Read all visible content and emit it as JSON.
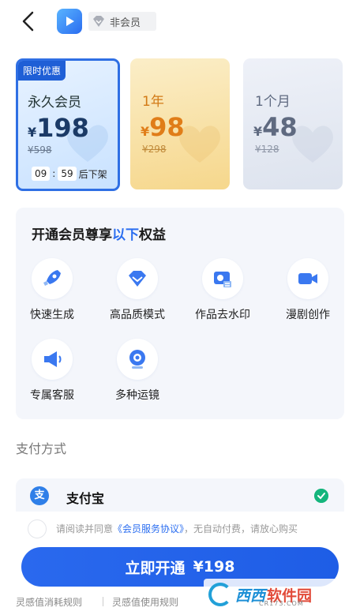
{
  "header": {
    "member_status": "非会员"
  },
  "plans": [
    {
      "tag": "限时优惠",
      "name": "永久会员",
      "currency": "¥",
      "price": "198",
      "original": "¥598",
      "countdown": {
        "hours": "09",
        "minutes": "59",
        "suffix": "后下架"
      },
      "selected": true
    },
    {
      "name": "1年",
      "currency": "¥",
      "price": "98",
      "original": "¥298",
      "selected": false
    },
    {
      "name": "1个月",
      "currency": "¥",
      "price": "48",
      "original": "¥128",
      "selected": false
    }
  ],
  "benefits": {
    "title_prefix": "开通会员尊享",
    "title_highlight": "以下",
    "title_suffix": "权益",
    "items": [
      {
        "label": "快速生成",
        "icon": "rocket-icon"
      },
      {
        "label": "高品质模式",
        "icon": "diamond-icon"
      },
      {
        "label": "作品去水印",
        "icon": "watermark-removal-icon"
      },
      {
        "label": "漫剧创作",
        "icon": "video-camera-icon"
      },
      {
        "label": "专属客服",
        "icon": "megaphone-icon"
      },
      {
        "label": "多种运镜",
        "icon": "camera-lens-icon"
      }
    ]
  },
  "payment": {
    "section_title": "支付方式",
    "method": "支付宝",
    "method_icon_char": "支",
    "selected": true
  },
  "agreement": {
    "prefix": "请阅读并同意",
    "link": "《会员服务协议》",
    "suffix": "，无自动付费，请放心购买"
  },
  "cta": {
    "label": "立即开通",
    "price": "¥198"
  },
  "footer": {
    "links": [
      "灵感值消耗规则",
      "灵感值使用规则"
    ]
  },
  "watermark": {
    "brand": "西西",
    "brand2": "软件园",
    "url": "CR173.COM"
  },
  "colors": {
    "accent": "#2b6ef0",
    "gold": "#e07d18",
    "success": "#15b57c"
  }
}
